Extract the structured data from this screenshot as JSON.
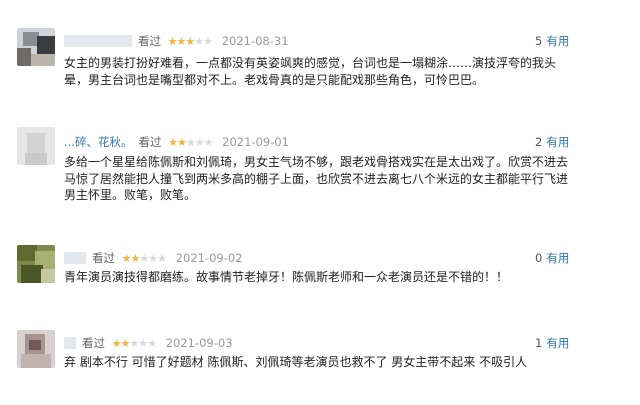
{
  "reviews": [
    {
      "username": "",
      "seen_label": "看过",
      "rating": 3,
      "star_glyph": "★",
      "date": "2021-08-31",
      "votes": "5",
      "useful_label": "有用",
      "text": "女主的男装打扮好难看，一点都没有英姿飒爽的感觉，台词也是一塌糊涂……演技浮夸的我头晕，男主台词也是嘴型都对不上。老戏骨真的是只能配戏那些角色，可怜巴巴。"
    },
    {
      "username": "...碎、花秋。",
      "seen_label": "看过",
      "rating": 2,
      "star_glyph": "★",
      "date": "2021-09-01",
      "votes": "2",
      "useful_label": "有用",
      "text": "多给一个星星给陈佩斯和刘佩琦，男女主气场不够，跟老戏骨搭戏实在是太出戏了。欣赏不进去马惊了居然能把人撞飞到两米多高的棚子上面，也欣赏不进去离七八个米远的女主都能平行飞进男主怀里。败笔，败笔。"
    },
    {
      "username": "",
      "seen_label": "看过",
      "rating": 2,
      "star_glyph": "★",
      "date": "2021-09-02",
      "votes": "0",
      "useful_label": "有用",
      "text": "青年演员演技得都磨练。故事情节老掉牙！陈佩斯老师和一众老演员还是不错的！！"
    },
    {
      "username": "",
      "seen_label": "看过",
      "rating": 2,
      "star_glyph": "★",
      "date": "2021-09-03",
      "votes": "1",
      "useful_label": "有用",
      "text": "弃 剧本不行 可惜了好题材 陈佩斯、刘佩琦等老演员也救不了 男女主带不起来 不吸引人"
    }
  ]
}
